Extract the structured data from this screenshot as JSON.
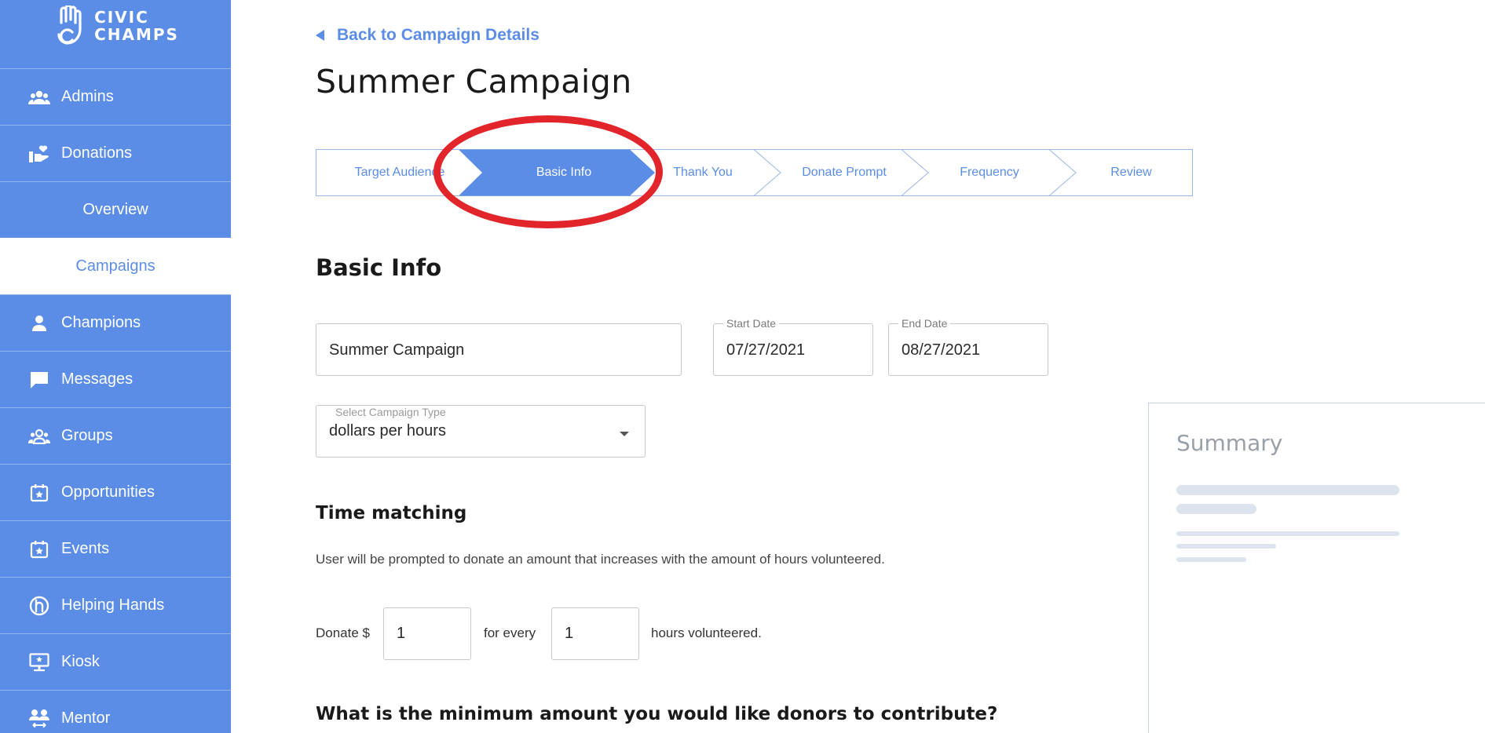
{
  "brand": {
    "line1": "CIVIC",
    "line2": "CHAMPS"
  },
  "sidebar": {
    "items": [
      {
        "label": "Admins",
        "icon": "people-icon"
      },
      {
        "label": "Donations",
        "icon": "hand-heart-icon"
      },
      {
        "label": "Overview",
        "sub": true
      },
      {
        "label": "Campaigns",
        "sub": true,
        "active": true
      },
      {
        "label": "Champions",
        "icon": "person-icon"
      },
      {
        "label": "Messages",
        "icon": "chat-bubble-icon"
      },
      {
        "label": "Groups",
        "icon": "group-icon"
      },
      {
        "label": "Opportunities",
        "icon": "calendar-star-icon"
      },
      {
        "label": "Events",
        "icon": "calendar-star-icon"
      },
      {
        "label": "Helping Hands",
        "icon": "helping-hands-icon"
      },
      {
        "label": "Kiosk",
        "icon": "kiosk-icon"
      },
      {
        "label": "Mentor",
        "icon": "mentor-icon"
      }
    ]
  },
  "header": {
    "back_label": "Back to Campaign Details",
    "title": "Summer Campaign"
  },
  "stepper": {
    "steps": [
      "Target Audience",
      "Basic Info",
      "Thank You",
      "Donate Prompt",
      "Frequency",
      "Review"
    ],
    "active_index": 1
  },
  "form": {
    "section_title": "Basic Info",
    "name_value": "Summer Campaign",
    "start_date": {
      "label": "Start Date",
      "value": "07/27/2021"
    },
    "end_date": {
      "label": "End Date",
      "value": "08/27/2021"
    },
    "campaign_type": {
      "label": "Select Campaign Type",
      "value": "dollars per hours"
    },
    "time_matching": {
      "title": "Time matching",
      "description": "User will be prompted to donate an amount that increases with the amount of hours volunteered.",
      "donate_prefix": "Donate $",
      "amount": "1",
      "for_every": "for every",
      "hours": "1",
      "suffix": "hours volunteered."
    },
    "minimum_question": "What is the minimum amount you would like donors to contribute?"
  },
  "summary": {
    "title": "Summary"
  },
  "colors": {
    "primary": "#5b8de6",
    "annotation": "#e1252b"
  }
}
